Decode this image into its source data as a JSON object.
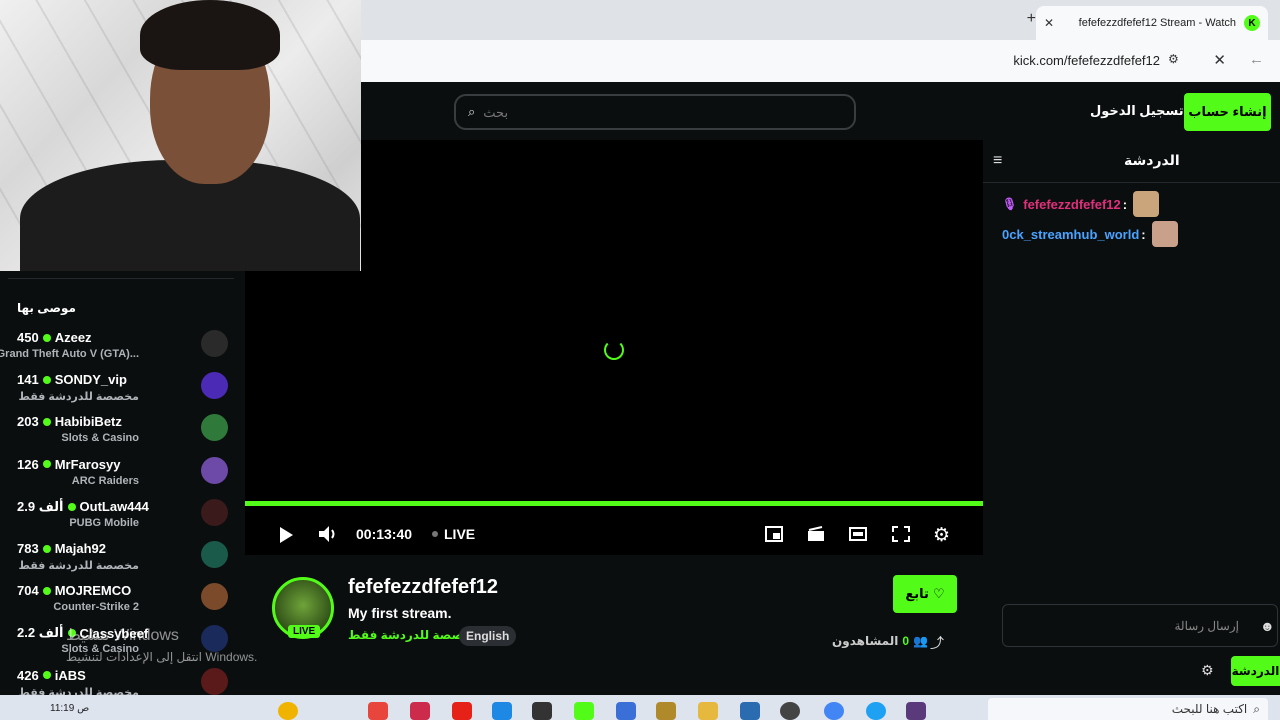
{
  "browser": {
    "tab_title": "fefefezzdfefef12 Stream - Watch",
    "url": "kick.com/fefefezzdfefef12",
    "new_tab": "+",
    "close": "✕"
  },
  "header": {
    "search_placeholder": "بحث",
    "login_label": "تسجيل الدخول",
    "signup_label": "إنشاء حساب"
  },
  "sidebar": {
    "title": "موصى بها",
    "channels": [
      {
        "name": "Azeez",
        "viewers": "450",
        "category": "Grand Theft Auto V (GTA)...",
        "avatar_color": "#2a2a2a"
      },
      {
        "name": "SONDY_vip",
        "viewers": "141",
        "category": "مخصصة للدردشة فقط",
        "avatar_color": "#4b2bb5"
      },
      {
        "name": "HabibiBetz",
        "viewers": "203",
        "category": "Slots & Casino",
        "avatar_color": "#2f7a3a"
      },
      {
        "name": "MrFarosyy",
        "viewers": "126",
        "category": "ARC Raiders",
        "avatar_color": "#6d4aa8"
      },
      {
        "name": "OutLaw444",
        "viewers": "2.9 ألف",
        "category": "PUBG Mobile",
        "avatar_color": "#3a1a1a"
      },
      {
        "name": "Majah92",
        "viewers": "783",
        "category": "مخصصة للدردشة فقط",
        "avatar_color": "#1a5a4a"
      },
      {
        "name": "MOJREMCO",
        "viewers": "704",
        "category": "Counter-Strike 2",
        "avatar_color": "#7a4a2a"
      },
      {
        "name": "Classybeef",
        "viewers": "2.2 ألف",
        "category": "Slots & Casino",
        "avatar_color": "#1a2a5a"
      },
      {
        "name": "iABS",
        "viewers": "426",
        "category": "مخصصة للدردشة فقط",
        "avatar_color": "#5a1a1a"
      }
    ]
  },
  "player": {
    "time": "00:13:40",
    "live": "LIVE"
  },
  "channel": {
    "name": "fefefezzdfefef12",
    "title": "My first stream.",
    "category": "مخصصة للدردشة فقط",
    "language": "English",
    "live_badge": "LIVE",
    "follow_label": "تابع",
    "viewers_label": "المشاهدون",
    "viewers_count": "0"
  },
  "chat": {
    "title": "الدردشة",
    "messages": [
      {
        "user": "fefefezzdfefef12",
        "sep": ":"
      },
      {
        "user": "0ck_streamhub_world",
        "sep": ":"
      }
    ],
    "input_placeholder": "إرسال رسالة",
    "send_label": "الدردشة"
  },
  "windows": {
    "activate_title": "تنشيط Windows",
    "activate_sub": "انتقل إلى الإعدادات لتنشيط Windows.",
    "search_placeholder": "اكتب هنا للبحث",
    "clock": "11:19 ص"
  },
  "colors": {
    "accent": "#53fc18",
    "background": "#0b0e0f"
  }
}
